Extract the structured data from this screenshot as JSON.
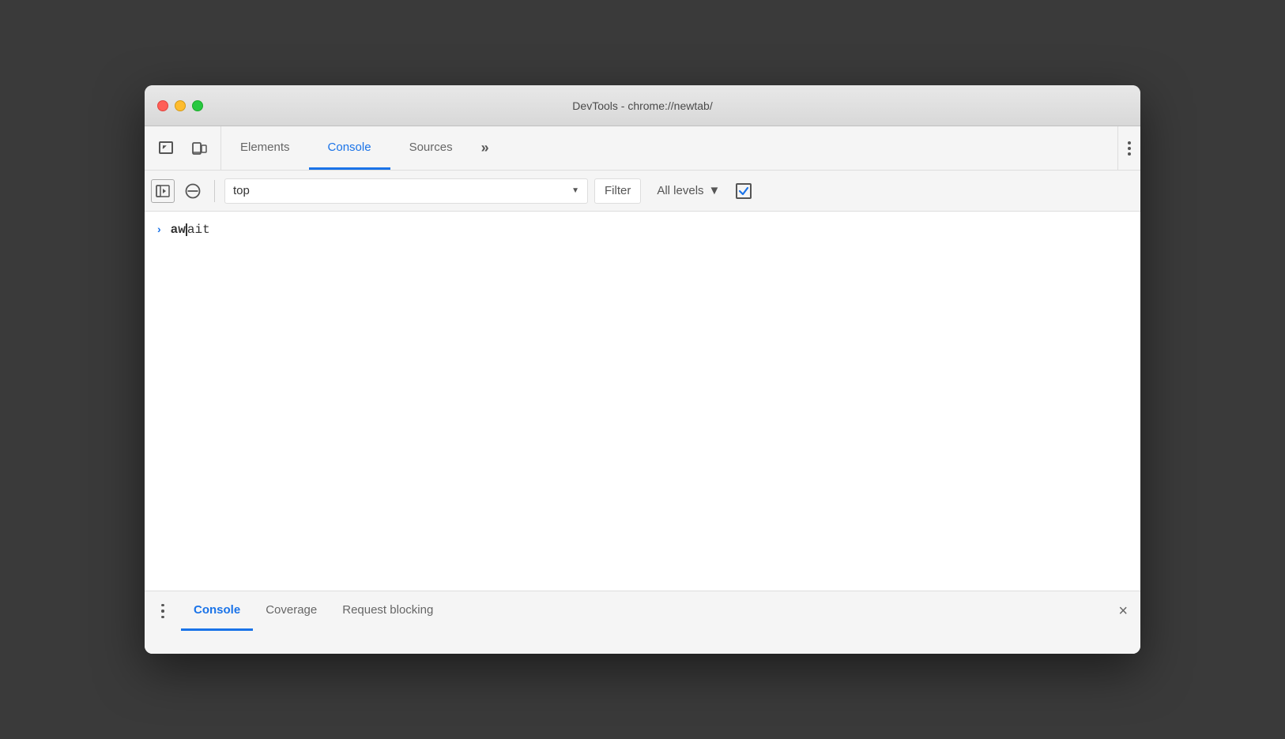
{
  "window": {
    "title": "DevTools - chrome://newtab/"
  },
  "titlebar": {
    "close": "close",
    "minimize": "minimize",
    "maximize": "maximize"
  },
  "topToolbar": {
    "inspect_icon": "inspect",
    "device_icon": "device-toggle",
    "tabs": [
      {
        "id": "elements",
        "label": "Elements",
        "active": false
      },
      {
        "id": "console",
        "label": "Console",
        "active": true
      },
      {
        "id": "sources",
        "label": "Sources",
        "active": false
      }
    ],
    "more_tabs": "»",
    "more_options": "⋮"
  },
  "consoleToolbar": {
    "sidebar_icon": "sidebar-toggle",
    "clear_icon": "clear-console",
    "context_label": "top",
    "filter_placeholder": "Filter",
    "all_levels_label": "All levels",
    "levels_arrow": "▼"
  },
  "consoleContent": {
    "prompt_arrow": "›",
    "input_bold": "aw",
    "input_mono": "ait"
  },
  "bottomDrawer": {
    "tabs": [
      {
        "id": "console",
        "label": "Console",
        "active": true
      },
      {
        "id": "coverage",
        "label": "Coverage",
        "active": false
      },
      {
        "id": "request-blocking",
        "label": "Request blocking",
        "active": false
      }
    ],
    "close_label": "×"
  }
}
